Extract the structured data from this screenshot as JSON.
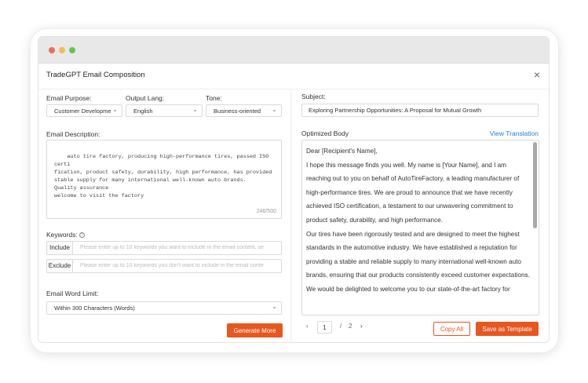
{
  "window": {
    "title": "TradeGPT Email Composition"
  },
  "form": {
    "purpose_label": "Email Purpose:",
    "purpose_value": "Customer Development",
    "lang_label": "Output Lang:",
    "lang_value": "English",
    "tone_label": "Tone:",
    "tone_value": "Business-oriented",
    "description_label": "Email Description:",
    "description_text": "auto tire factory, producing high-performance tires, passed ISO certi\nfication, product safety, durability, high performance, has provided\nstable supply for many international well-known auto brands.\nQuality assurance\nwelcome to visit the factory",
    "char_count": "246/500",
    "keywords_label": "Keywords:",
    "help_icon": "question-circle-icon",
    "include_label": "Include",
    "include_placeholder": "Please enter up to 10 keywords you want to include in the email content, se",
    "exclude_label": "Exclude",
    "exclude_placeholder": "Please enter up to 10 keywords you don't want to include in the email conte",
    "limit_label": "Email Word Limit:",
    "limit_value": "Within 300 Characters (Words)",
    "generate_label": "Generate More"
  },
  "output": {
    "subject_label": "Subject:",
    "subject_value": "Exploring Partnership Opportunities: A Proposal for Mutual Growth",
    "body_label": "Optimized Body",
    "view_translation": "View Translation",
    "body_lines": [
      "Dear [Recipient's Name],",
      "I hope this message finds you well. My name is [Your Name], and I am reaching out to you on behalf of AutoTireFactory, a leading manufacturer of high-performance tires. We are proud to announce that we have recently achieved ISO certification, a testament to our unwavering commitment to product safety, durability, and high performance.",
      "Our tires have been rigorously tested and are designed to meet the highest standards in the automotive industry. We have established a reputation for providing a stable and reliable supply to many international well-known auto brands, ensuring that our products consistently exceed customer expectations.",
      "We would be delighted to welcome you to our state-of-the-art factory for"
    ],
    "page_prev": "‹",
    "page_current": "1",
    "page_sep": "/",
    "page_total": "2",
    "page_next": "›",
    "copy_label": "Copy All",
    "save_label": "Save as Template"
  },
  "colors": {
    "accent": "#e8571f",
    "link": "#1e7fd6"
  }
}
